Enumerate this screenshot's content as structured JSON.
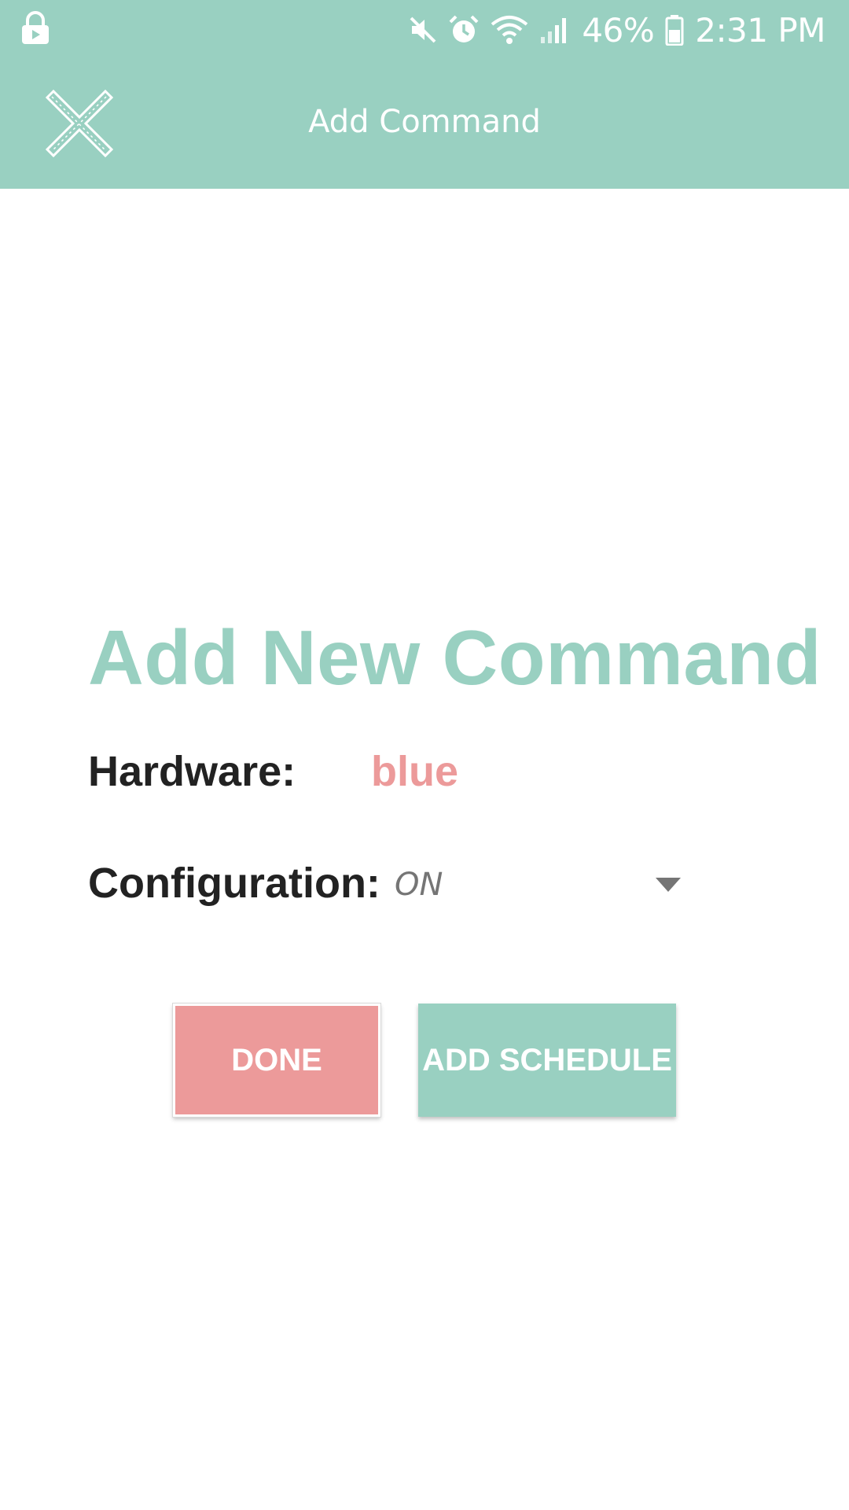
{
  "status_bar": {
    "battery_percent": "46%",
    "time": "2:31 PM",
    "icons": [
      "lock-icon",
      "mute-icon",
      "alarm-icon",
      "wifi-icon",
      "signal-icon",
      "battery-icon"
    ]
  },
  "toolbar": {
    "title": "Add Command",
    "close_icon": "close-icon"
  },
  "form": {
    "heading": "Add New Command",
    "hardware_label": "Hardware:",
    "hardware_value": "blue",
    "configuration_label": "Configuration:",
    "configuration_value": "ON"
  },
  "actions": {
    "done_label": "DONE",
    "add_schedule_label": "ADD SCHEDULE"
  },
  "colors": {
    "accent": "#99d0c1",
    "highlight": "#ec9a9a",
    "text_dark": "#222222",
    "text_muted": "#757575"
  }
}
